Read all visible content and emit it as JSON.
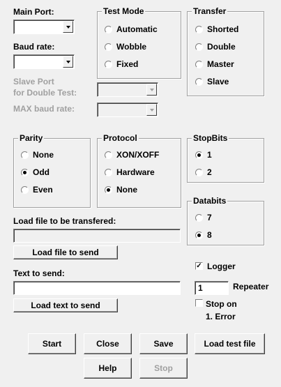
{
  "main_port": {
    "label": "Main Port:",
    "value": ""
  },
  "baud_rate": {
    "label": "Baud rate:",
    "value": ""
  },
  "slave_port": {
    "label1": "Slave Port",
    "label2": "for Double Test:"
  },
  "max_baud": {
    "label": "MAX baud rate:"
  },
  "test_mode": {
    "title": "Test Mode",
    "options": [
      "Automatic",
      "Wobble",
      "Fixed"
    ],
    "selected": null
  },
  "transfer": {
    "title": "Transfer",
    "options": [
      "Shorted",
      "Double",
      "Master",
      "Slave"
    ],
    "selected": null
  },
  "parity": {
    "title": "Parity",
    "options": [
      "None",
      "Odd",
      "Even"
    ],
    "selected": "Odd"
  },
  "protocol": {
    "title": "Protocol",
    "options": [
      "XON/XOFF",
      "Hardware",
      "None"
    ],
    "selected": "None"
  },
  "stopbits": {
    "title": "StopBits",
    "options": [
      "1",
      "2"
    ],
    "selected": "1"
  },
  "databits": {
    "title": "Databits",
    "options": [
      "7",
      "8"
    ],
    "selected": "8"
  },
  "load_file": {
    "label": "Load file to be transfered:",
    "value": "",
    "button": "Load file to send"
  },
  "text_send": {
    "label": "Text to send:",
    "value": "",
    "button": "Load text to send"
  },
  "logger": {
    "label": "Logger",
    "checked": true
  },
  "repeater": {
    "label": "Repeater",
    "value": "1"
  },
  "stop_on_error": {
    "label1": "Stop on",
    "label2": "1. Error",
    "checked": false
  },
  "buttons": {
    "start": "Start",
    "close": "Close",
    "save": "Save",
    "load_test": "Load test file",
    "help": "Help",
    "stop": "Stop"
  }
}
